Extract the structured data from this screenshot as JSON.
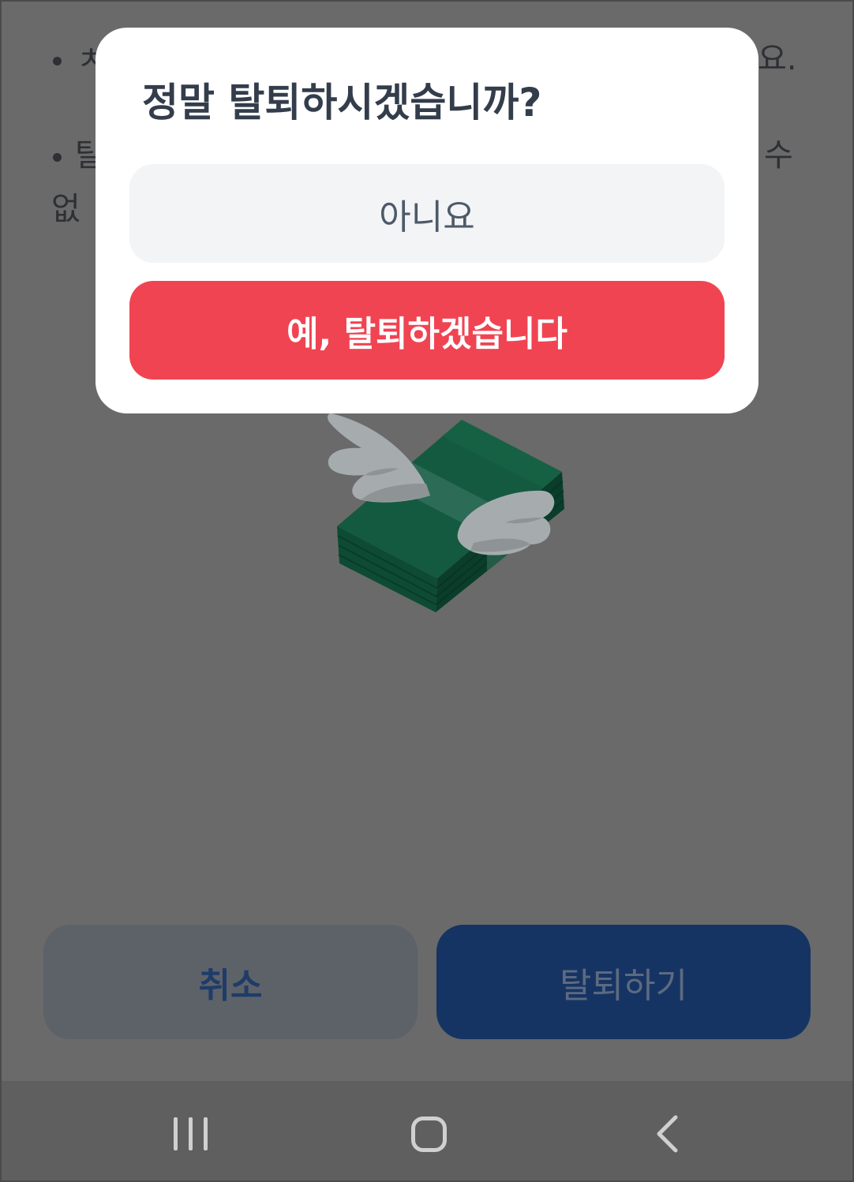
{
  "background_page": {
    "notice_lines": [
      {
        "left": "ㅊ",
        "right": "요."
      },
      {
        "left": "탈",
        "right": "수"
      },
      {
        "left": "없"
      }
    ],
    "illustration": {
      "icon": "flying-money-icon"
    }
  },
  "footer": {
    "cancel_label": "취소",
    "withdraw_label": "탈퇴하기"
  },
  "dialog": {
    "title": "정말 탈퇴하시겠습니까?",
    "cancel_label": "아니요",
    "confirm_label": "예, 탈퇴하겠습니다"
  },
  "nav_bar": {
    "recent_icon": "recent-apps-icon",
    "home_icon": "home-icon",
    "back_icon": "back-icon"
  },
  "colors": {
    "dimmed_background": "#6a6a6a",
    "dialog_background": "#ffffff",
    "dialog_title": "#333d4b",
    "dialog_cancel_bg": "#f2f4f6",
    "dialog_cancel_text": "#4e5968",
    "dialog_confirm_bg": "#f04452",
    "dialog_confirm_text": "#ffffff"
  }
}
